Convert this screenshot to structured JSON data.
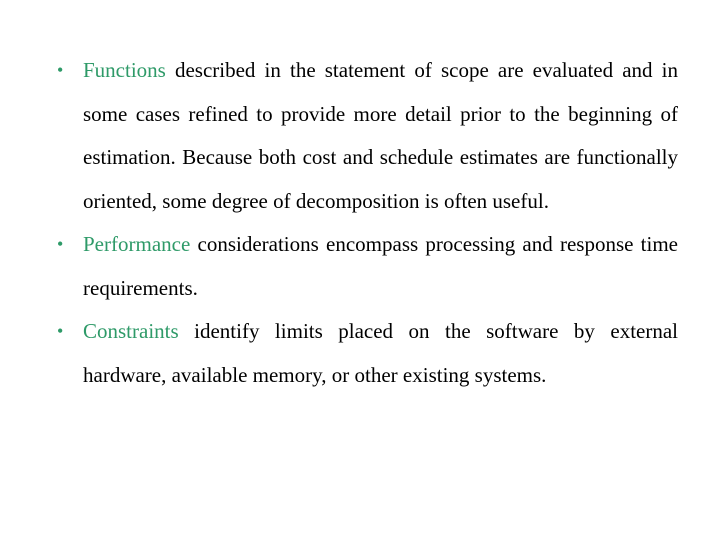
{
  "accent_color": "#2e9a68",
  "bullets": [
    {
      "keyword": "Functions",
      "text": " described in the statement of scope are evaluated and in some cases refined to provide more detail prior to the beginning of estimation. Because both cost and schedule estimates are functionally oriented, some degree of decomposition is often useful."
    },
    {
      "keyword": "Performance",
      "text": " considerations encompass processing and response time requirements."
    },
    {
      "keyword": "Constraints",
      "text": " identify limits placed on the software by external hardware, available memory, or other existing systems."
    }
  ],
  "bullet_glyph": "•"
}
